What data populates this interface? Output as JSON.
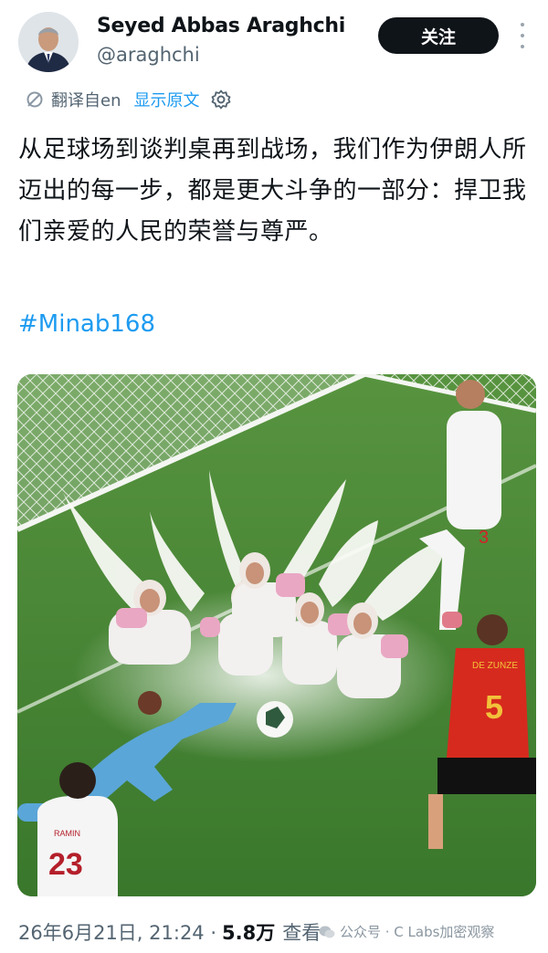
{
  "author": {
    "name": "Seyed Abbas Araghchi",
    "handle": "@araghchi"
  },
  "follow_label": "关注",
  "translation": {
    "translated_from": "翻译自en",
    "show_original": "显示原文"
  },
  "tweet": {
    "text": "从足球场到谈判桌再到战场，我们作为伊朗人所迈出的每一步，都是更大斗争的一部分：捍卫我们亲爱的人民的荣誉与尊严。",
    "hashtag": "#Minab168"
  },
  "media": {
    "jersey_numbers": [
      "3",
      "5",
      "23"
    ],
    "jersey_names": [
      "DE ZUNZE",
      "RAMIN"
    ]
  },
  "meta": {
    "timestamp": "26年6月21日, 21:24 · ",
    "views": "5.8万",
    "views_label": "查看"
  },
  "watermark": "公众号 · C Labs加密观察",
  "colors": {
    "accent": "#1d9bf0",
    "text": "#0f1419",
    "secondary": "#536471",
    "follow_bg": "#0f1419"
  },
  "icons": [
    "avatar",
    "more-icon",
    "translate-icon",
    "gear-icon",
    "wechat-icon"
  ]
}
